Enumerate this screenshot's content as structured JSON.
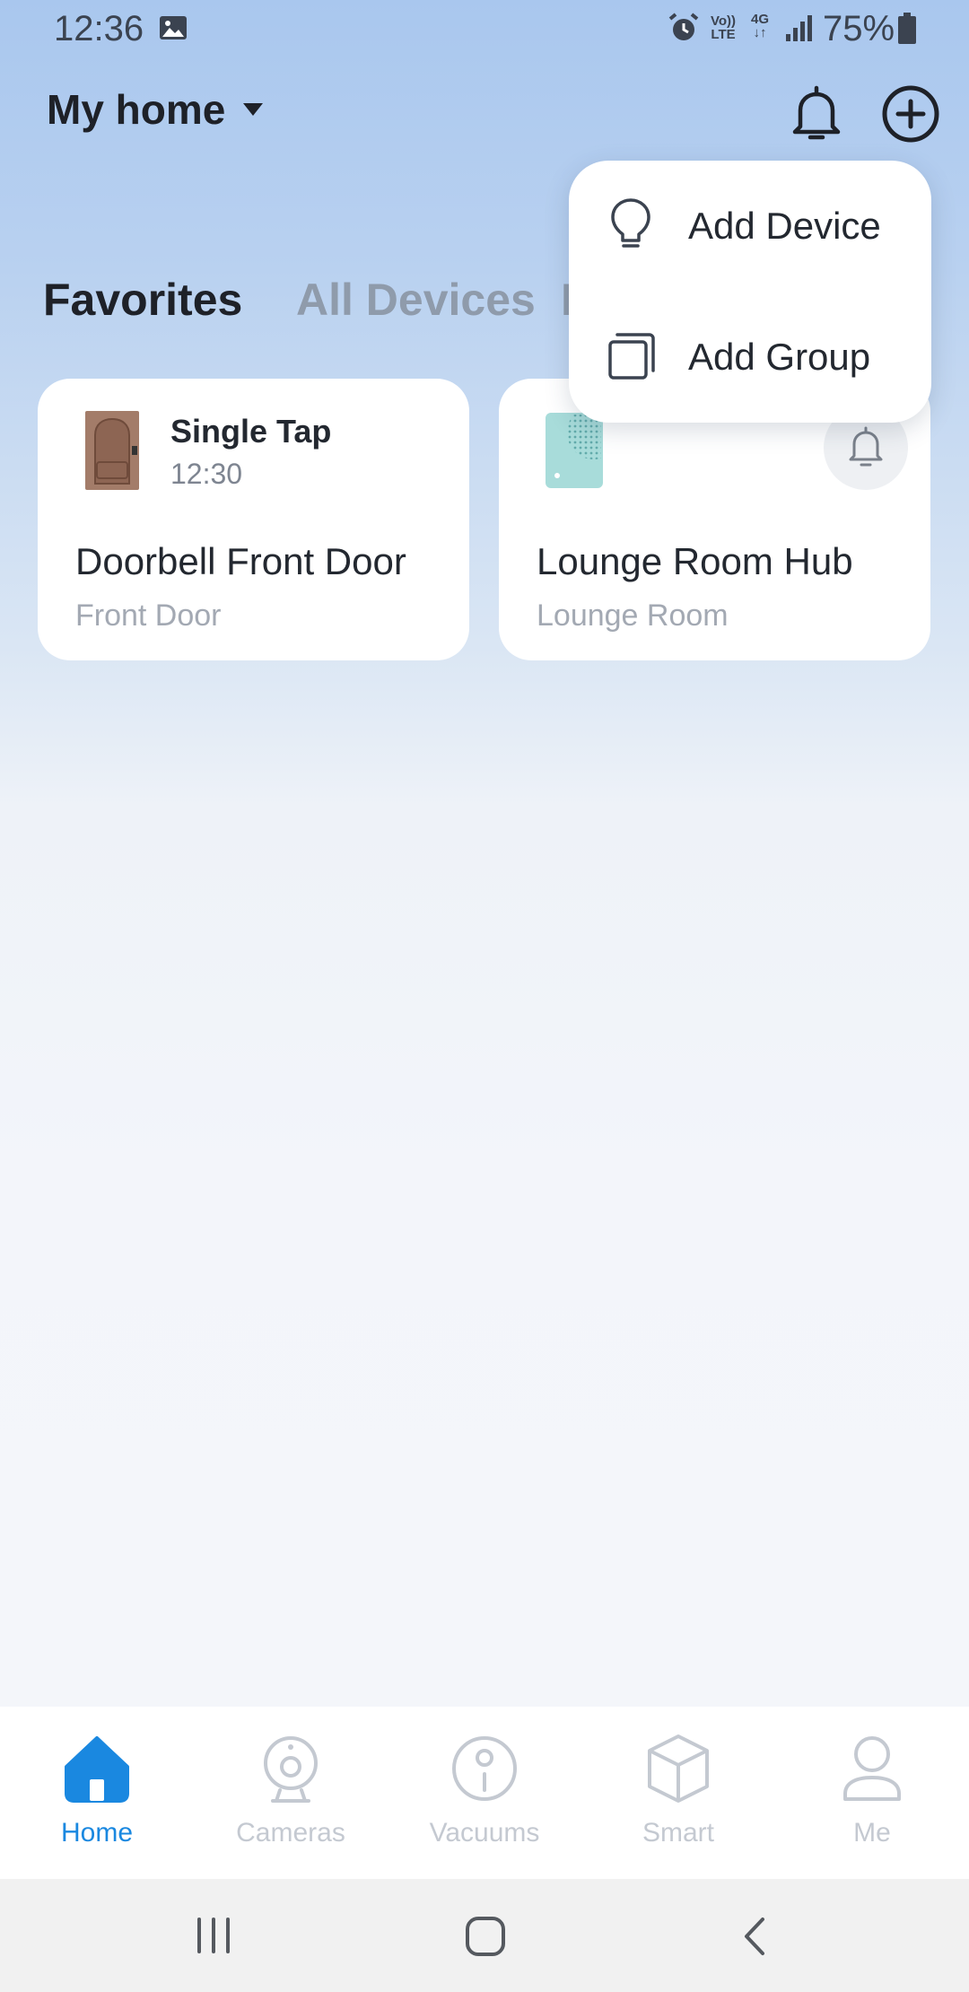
{
  "status_bar": {
    "time": "12:36",
    "volte_line1": "Vo))",
    "volte_line2": "LTE",
    "network": "4G",
    "battery": "75%"
  },
  "header": {
    "home_name": "My home",
    "icons": [
      "caret-down-icon",
      "bell-icon",
      "add-circle-icon"
    ]
  },
  "tabs": [
    {
      "label": "Favorites",
      "active": true
    },
    {
      "label": "All Devices",
      "active": false
    },
    {
      "label": "I",
      "active": false
    }
  ],
  "devices": [
    {
      "event_title": "Single Tap",
      "event_time": "12:30",
      "name": "Doorbell Front Door",
      "room": "Front Door",
      "icon": "door-icon"
    },
    {
      "name": "Lounge Room Hub",
      "room": "Lounge Room",
      "icon": "hub-device-icon",
      "action_icon": "bell-icon"
    }
  ],
  "add_menu": {
    "items": [
      {
        "label": "Add Device",
        "icon": "lightbulb-icon"
      },
      {
        "label": "Add Group",
        "icon": "group-icon"
      }
    ]
  },
  "bottom_nav": {
    "items": [
      {
        "label": "Home",
        "icon": "home-icon",
        "active": true
      },
      {
        "label": "Cameras",
        "icon": "camera-icon",
        "active": false
      },
      {
        "label": "Vacuums",
        "icon": "vacuum-icon",
        "active": false
      },
      {
        "label": "Smart",
        "icon": "cube-icon",
        "active": false
      },
      {
        "label": "Me",
        "icon": "person-icon",
        "active": false
      }
    ]
  },
  "colors": {
    "accent": "#1a88e0",
    "inactive": "#c4c9d1",
    "text_dark": "#1e2128",
    "tab_inactive": "#8f9bab"
  }
}
